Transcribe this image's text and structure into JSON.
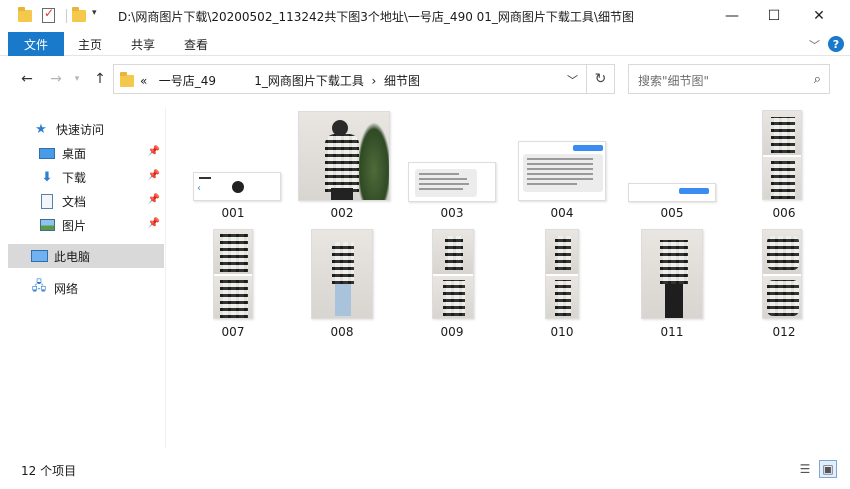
{
  "window": {
    "title": "D:\\网商图片下载\\20200502_113242共下图3个地址\\一号店_490          01_网商图片下载工具\\细节图",
    "controls": {
      "minimize": "—",
      "maximize": "☐",
      "close": "✕"
    }
  },
  "ribbon": {
    "tabs": [
      "文件",
      "主页",
      "共享",
      "查看"
    ],
    "help": "?"
  },
  "address": {
    "prefix": "«",
    "segments": [
      "一号店_49          1_网商图片下载工具",
      "细节图"
    ],
    "separator": "›"
  },
  "search": {
    "placeholder": "搜索\"细节图\""
  },
  "sidebar": {
    "quick_access": "快速访问",
    "items": [
      {
        "label": "桌面",
        "pinned": true
      },
      {
        "label": "下载",
        "pinned": true
      },
      {
        "label": "文档",
        "pinned": true
      },
      {
        "label": "图片",
        "pinned": true
      }
    ],
    "this_pc": "此电脑",
    "network": "网络"
  },
  "files": [
    "001",
    "002",
    "003",
    "004",
    "005",
    "006",
    "007",
    "008",
    "009",
    "010",
    "011",
    "012"
  ],
  "status": {
    "count_text": "12 个项目"
  },
  "colors": {
    "accent": "#1979ca",
    "selection": "#cce8ff",
    "folder": "#f4c84a"
  }
}
